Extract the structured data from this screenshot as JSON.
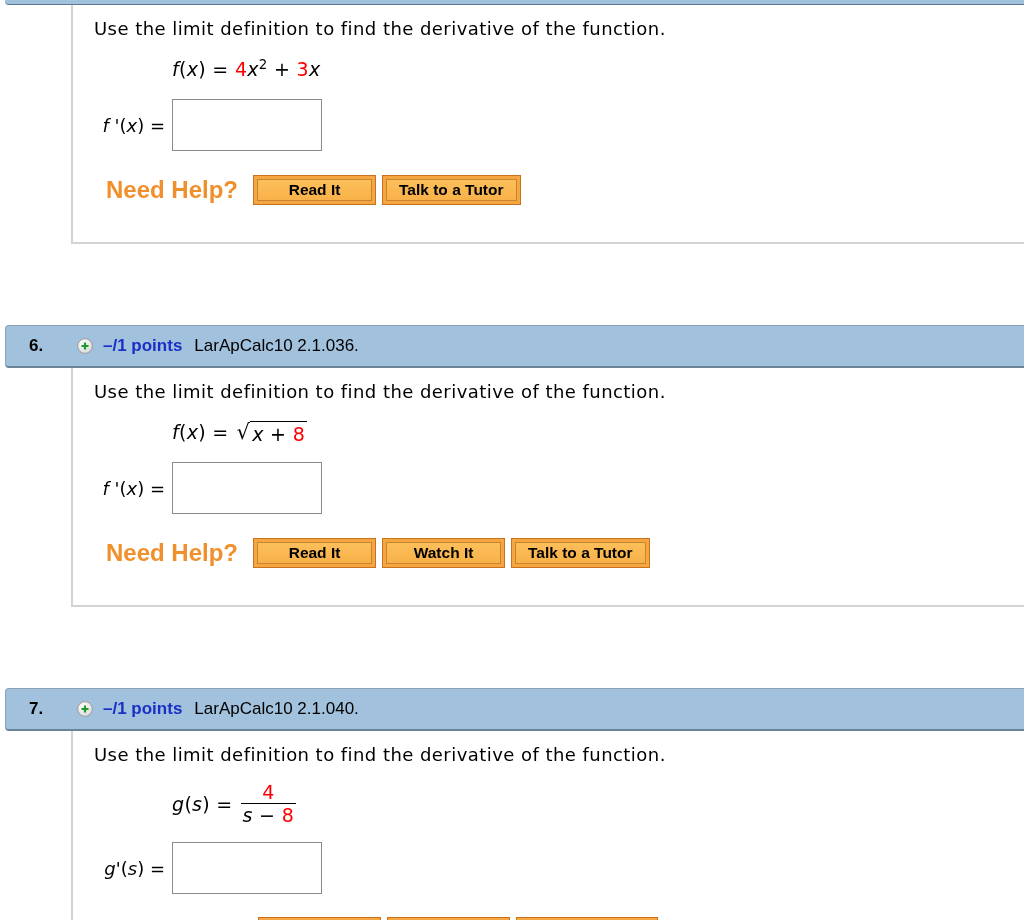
{
  "questions": [
    {
      "header": {
        "kind": "edge"
      },
      "prompt": "Use the limit definition to find the derivative of the function.",
      "function": {
        "kind": "poly",
        "lhs": "*f*(*x*) =",
        "terms": [
          {
            "text": "4",
            "color": "#ff0000"
          },
          {
            "text": "*x*$^{2}$ + ",
            "color": "#000000"
          },
          {
            "text": "3",
            "color": "#ff0000"
          },
          {
            "text": "*x*",
            "color": "#000000"
          }
        ]
      },
      "answer": {
        "label": "*f* '(*x*) ="
      },
      "help": {
        "title": "Need Help?",
        "buttons": [
          {
            "kind": "full",
            "label": "Read It"
          },
          {
            "kind": "full",
            "label": "Talk to a Tutor"
          }
        ]
      }
    },
    {
      "header": {
        "kind": "full",
        "number": "6.",
        "points": "–/1 points",
        "source": "LarApCalc10 2.1.036."
      },
      "prompt": "Use the limit definition to find the derivative of the function.",
      "function": {
        "kind": "sqrt",
        "lhs": "*f*(*x*) =",
        "radical": "√",
        "terms": [
          {
            "text": "*x* + ",
            "color": "#000000"
          },
          {
            "text": "8",
            "color": "#ff0000"
          }
        ]
      },
      "answer": {
        "label": "*f* '(*x*) ="
      },
      "help": {
        "title": "Need Help?",
        "buttons": [
          {
            "kind": "full",
            "label": "Read It"
          },
          {
            "kind": "full",
            "label": "Watch It"
          },
          {
            "kind": "full",
            "label": "Talk to a Tutor"
          }
        ]
      }
    },
    {
      "header": {
        "kind": "full",
        "number": "7.",
        "points": "–/1 points",
        "source": "LarApCalc10 2.1.040."
      },
      "prompt": "Use the limit definition to find the derivative of the function.",
      "function": {
        "kind": "fraction",
        "lhs": "*g*(*s*) =",
        "numerator": [
          {
            "text": "4",
            "color": "#ff0000"
          }
        ],
        "denominator": [
          {
            "text": "*s* − ",
            "color": "#000000"
          },
          {
            "text": "8",
            "color": "#ff0000"
          }
        ]
      },
      "answer": {
        "label": "*g*'(*s*) ="
      },
      "help": {
        "buttons": [
          {
            "kind": "cut"
          },
          {
            "kind": "cut"
          },
          {
            "kind": "cut"
          }
        ]
      }
    }
  ]
}
